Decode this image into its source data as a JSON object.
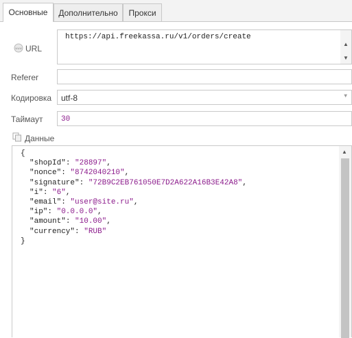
{
  "tabs": [
    {
      "label": "Основные"
    },
    {
      "label": "Дополнительно"
    },
    {
      "label": "Прокси"
    }
  ],
  "url": {
    "label": "URL",
    "value": "https://api.freekassa.ru/v1/orders/create"
  },
  "referer": {
    "label": "Referer",
    "value": ""
  },
  "encoding": {
    "label": "Кодировка",
    "value": "utf-8"
  },
  "timeout": {
    "label": "Таймаут",
    "value": "30"
  },
  "data": {
    "label": "Данные",
    "open_brace": "{",
    "close_brace": "}",
    "fields": [
      {
        "key": "\"shopId\"",
        "value": "\"28897\""
      },
      {
        "key": "\"nonce\"",
        "value": "\"8742040210\""
      },
      {
        "key": "\"signature\"",
        "value": "\"72B9C2EB761050E7D2A622A16B3E42A8\""
      },
      {
        "key": "\"i\"",
        "value": "\"6\""
      },
      {
        "key": "\"email\"",
        "value": "\"user@site.ru\""
      },
      {
        "key": "\"ip\"",
        "value": "\"0.0.0.0\""
      },
      {
        "key": "\"amount\"",
        "value": "\"10.00\""
      },
      {
        "key": "\"currency\"",
        "value": "\"RUB\""
      }
    ]
  },
  "colors": {
    "string": "#8b1a8b",
    "border": "#c9c9c9"
  },
  "icons": {
    "url": "globe-www-icon",
    "data": "copy-pages-icon"
  }
}
